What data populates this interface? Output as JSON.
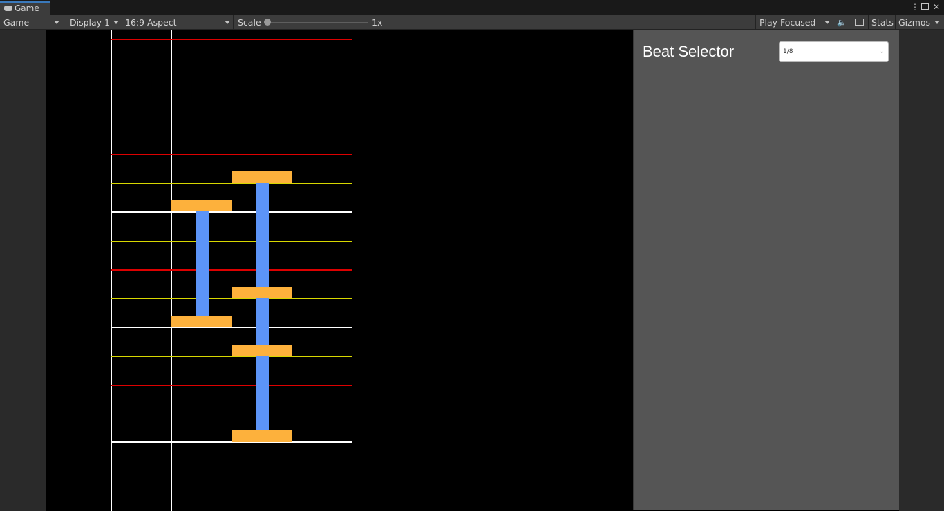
{
  "window": {
    "tab_label": "Game",
    "tab_icon": "gamepad-icon",
    "menu_icon": "kebab-menu-icon",
    "maximize_icon": "maximize-icon",
    "close_icon": "close-icon"
  },
  "toolbar": {
    "view_dropdown": "Game",
    "display_dropdown": "Display 1",
    "aspect_dropdown": "16:9 Aspect",
    "scale_label": "Scale",
    "scale_value": "1x",
    "scale_fraction": 0.0,
    "play_mode_dropdown": "Play Focused",
    "audio_icon": "speaker-icon",
    "grid_icon": "keyboard-icon",
    "stats_label": "Stats",
    "gizmos_label": "Gizmos"
  },
  "game_view": {
    "background": "#000000",
    "lane_line_color": "#ffffff",
    "beat_line_colors": {
      "measure": "#ffffff",
      "beat": "#dd0000",
      "half": "#ffffff",
      "quarter": "#d7d700"
    },
    "note_color": "#fdb13c",
    "hold_color": "#5c94f8"
  },
  "beat_selector": {
    "title": "Beat Selector",
    "selected": "1/8",
    "panel_color": "#555555"
  }
}
